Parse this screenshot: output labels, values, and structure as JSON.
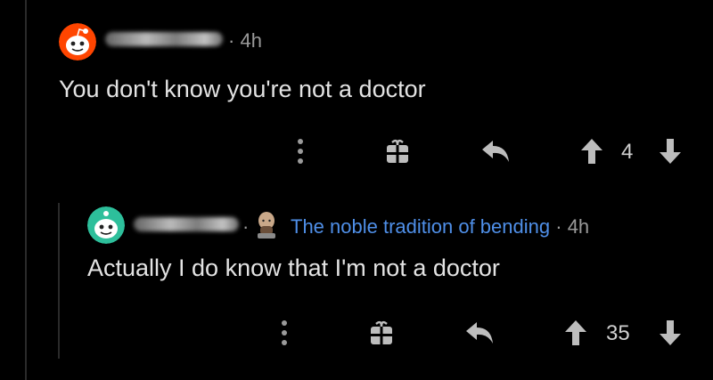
{
  "comments": [
    {
      "username_hidden": true,
      "time": "4h",
      "body": "You don't know you're not a doctor",
      "avatar_color": "#ff4500",
      "votes": "4"
    },
    {
      "username_hidden": true,
      "flair": "The noble tradition of bending",
      "time": "4h",
      "body": "Actually I do know that I'm not a doctor",
      "avatar_color": "#2dbf9b",
      "votes": "35"
    }
  ],
  "separator": "·",
  "icons": [
    "more-vertical-icon",
    "gift-icon",
    "reply-icon",
    "upvote-icon",
    "downvote-icon"
  ],
  "colors": {
    "background": "#000000",
    "text": "#e3e3e3",
    "meta": "#9a9a9a",
    "flair": "#4f8fe8"
  }
}
